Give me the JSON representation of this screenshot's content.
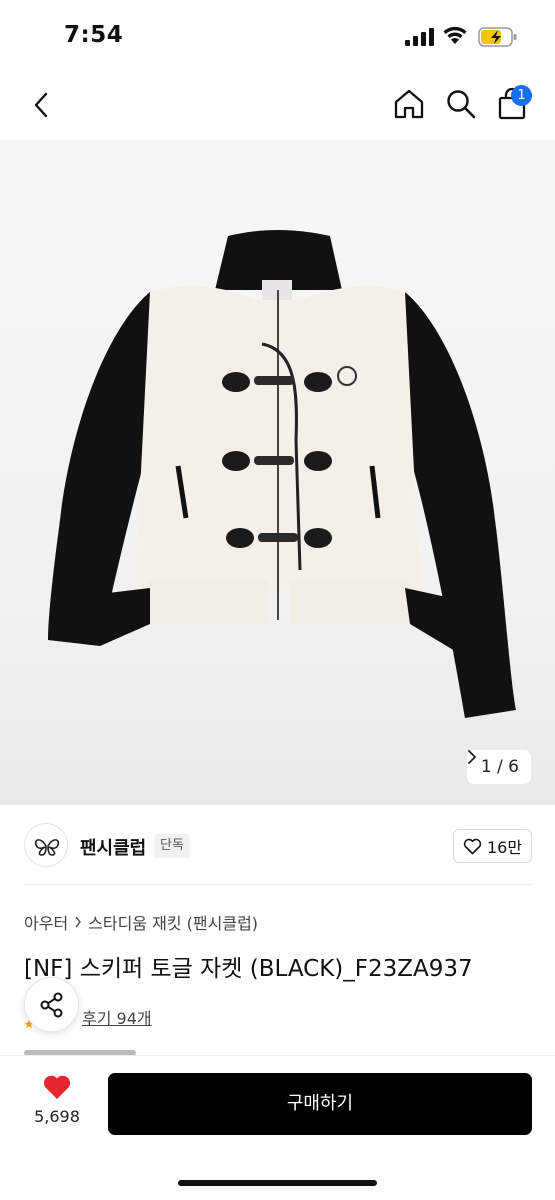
{
  "status_bar": {
    "time": "7:54",
    "icons": [
      "cellular-signal-icon",
      "wifi-icon",
      "battery-charging-icon"
    ],
    "battery_color": "#f5c400"
  },
  "nav": {
    "icons": [
      "back-chevron-icon",
      "home-icon",
      "search-icon",
      "shopping-bag-icon"
    ],
    "cart_badge": "1",
    "badge_color": "#1a6ef5"
  },
  "gallery": {
    "current": "1",
    "separator": "/",
    "total": "6",
    "pager_text": "1 / 6"
  },
  "brand": {
    "name": "팬시클럽",
    "badge": "단독",
    "likes": "16만",
    "logo_icon": "butterfly-logo-icon"
  },
  "product": {
    "breadcrumb": [
      "아우터",
      "스타디움 재킷 (팬시클럽)"
    ],
    "title": "[NF] 스키퍼 토글 자켓 (BLACK)_F23ZA937",
    "review_text": "후기 94개"
  },
  "actions": {
    "wish_count": "5,698",
    "wish_color": "#e8262d",
    "buy_label": "구매하기"
  }
}
